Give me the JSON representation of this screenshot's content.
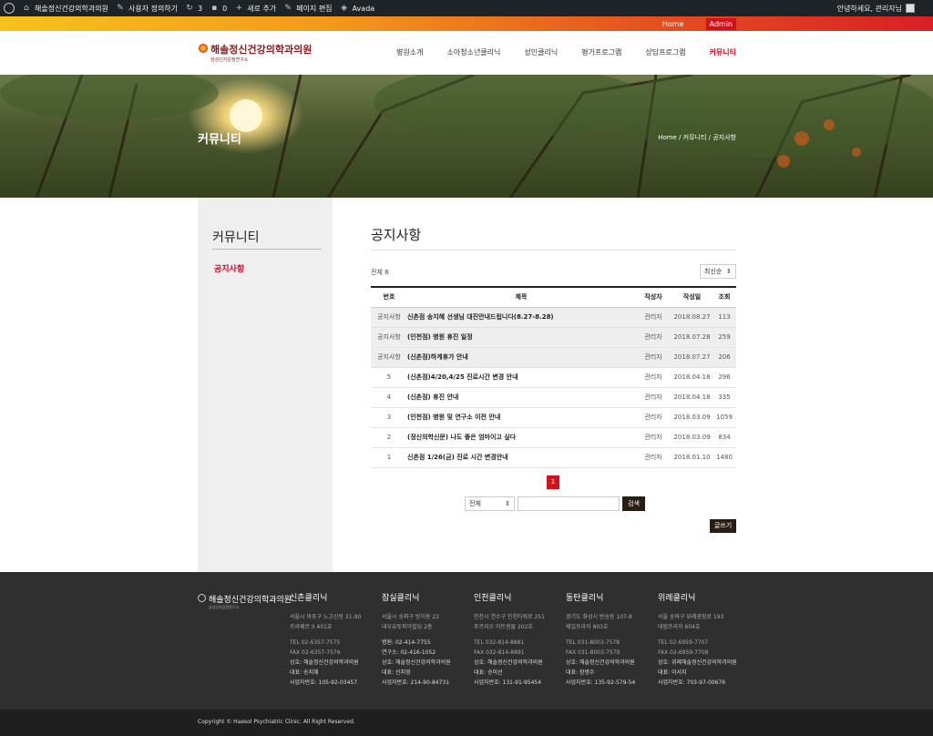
{
  "adminbar": {
    "site": "해솔정신건강의학과의원",
    "customize": "사용자 정의하기",
    "updates": "3",
    "comments": "0",
    "new": "새로 추가",
    "edit": "페이지 편집",
    "theme": "Avada",
    "greeting": "안녕하세요, 관리자님"
  },
  "topbar": {
    "home": "Home",
    "admin": "Admin"
  },
  "logo": {
    "name": "해솔정신건강의학과의원",
    "sub": "삼성인지감정연구소"
  },
  "nav": [
    "병원소개",
    "소아청소년클리닉",
    "성인클리닉",
    "평가프로그램",
    "상담프로그램",
    "커뮤니티"
  ],
  "hero": {
    "title": "커뮤니티",
    "breadcrumb": "Home / 커뮤니티 / 공지사항"
  },
  "sidebar": {
    "title": "커뮤니티",
    "item": "공지사항"
  },
  "board": {
    "title": "공지사항",
    "total": "전체 8",
    "sort": "최신순",
    "columns": {
      "num": "번호",
      "subject": "제목",
      "author": "작성자",
      "date": "작성일",
      "views": "조회"
    },
    "rows": [
      {
        "num": "공지사항",
        "subject": "신촌점 송지혜 선생님 대진안내드립니다(8.27-8.28)",
        "author": "관리자",
        "date": "2018.08.27",
        "views": "113",
        "notice": true
      },
      {
        "num": "공지사항",
        "subject": "(인천점) 병원 휴진 일정",
        "author": "관리자",
        "date": "2018.07.28",
        "views": "259",
        "notice": true
      },
      {
        "num": "공지사항",
        "subject": "(신촌점)하계휴가 안내",
        "author": "관리자",
        "date": "2018.07.27",
        "views": "206",
        "notice": true
      },
      {
        "num": "5",
        "subject": "(신촌점)4/20,4/25 진료시간 변경 안내",
        "author": "관리자",
        "date": "2018.04.18",
        "views": "296",
        "notice": false
      },
      {
        "num": "4",
        "subject": "(신촌점) 휴진 안내",
        "author": "관리자",
        "date": "2018.04.18",
        "views": "335",
        "notice": false
      },
      {
        "num": "3",
        "subject": "(인천점) 병원 및 연구소 이전 안내",
        "author": "관리자",
        "date": "2018.03.09",
        "views": "1059",
        "notice": false
      },
      {
        "num": "2",
        "subject": "(정신의학신문) 나도 좋은 엄마이고 싶다",
        "author": "관리자",
        "date": "2018.03.09",
        "views": "834",
        "notice": false
      },
      {
        "num": "1",
        "subject": "신촌점 1/26(금) 진료 시간 변경안내",
        "author": "관리자",
        "date": "2018.01.10",
        "views": "1480",
        "notice": false
      }
    ],
    "page": "1",
    "search_scope": "전체",
    "search_button": "검색",
    "write_button": "글쓰기"
  },
  "footer": {
    "logo_name": "해솔정신건강의학과의원",
    "logo_sub": "삼성인지감정연구소",
    "columns": [
      {
        "title": "신촌클리닉",
        "lines": [
          "서울시 마포구 노고산동 31-90",
          "프라페르 II 401호"
        ],
        "contacts": [
          "TEL 02-6357-7575",
          "FAX 02-6357-7576",
          "상호: 해솔정신건강의학과의원",
          "대표: 송지혜",
          "사업자번호: 105-92-03457"
        ]
      },
      {
        "title": "잠실클리닉",
        "lines": [
          "서울시 송파구 방이동 22",
          "대우유토피아빌딩 2층"
        ],
        "contacts": [
          "병원: 02-414-7755",
          "연구소: 02-416-1052",
          "상호: 해솔정신건강의학과의원",
          "대표: 신지영",
          "사업자번호: 214-90-84731"
        ]
      },
      {
        "title": "인천클리닉",
        "lines": [
          "인천시 연수구 인천타워로 251",
          "푸르지오 아트윈몰 202호"
        ],
        "contacts": [
          "TEL 032-814-8881",
          "FAX 032-814-8891",
          "상호: 해솔정신건강의학과의원",
          "대표: 송미선",
          "사업자번호: 131-91-95454"
        ]
      },
      {
        "title": "동탄클리닉",
        "lines": [
          "경기도 화성시 반송동 107-8",
          "제일프라자 803호"
        ],
        "contacts": [
          "TEL 031-8003-7578",
          "FAX 031-8003-7579",
          "상호: 해솔정신건강의학과의원",
          "대표: 장병수",
          "사업자번호: 135-92-579-54"
        ]
      },
      {
        "title": "위례클리닉",
        "lines": [
          "서울 송파구 위례광장로 193",
          "대림프라자 604호"
        ],
        "contacts": [
          "TEL 02-6959-7707",
          "FAX 02-6959-7708",
          "상호: 위례해솔정신건강의학과의원",
          "대표: 이서지",
          "사업자번호: 703-97-00676"
        ]
      }
    ],
    "copyright": "Copyright © Haesol Psychiatric Clinic. All Right Reserved."
  }
}
